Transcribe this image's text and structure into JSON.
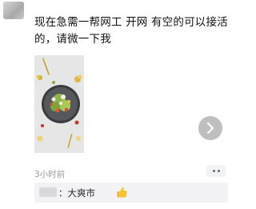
{
  "post": {
    "text": "现在急需一帮网工 开网   有空的可以接活的，请微一下我",
    "time": "3小时前"
  },
  "comment": {
    "text": "：大爽市"
  },
  "icons": {
    "next": "chevron-right-icon",
    "more": "more-dots-icon",
    "thumb": "thumbs-up-emoji-icon"
  },
  "colors": {
    "photo_bg": "#e7e7e7",
    "next_button": "#bfbfbf",
    "more_dots": "#5d6b88"
  }
}
